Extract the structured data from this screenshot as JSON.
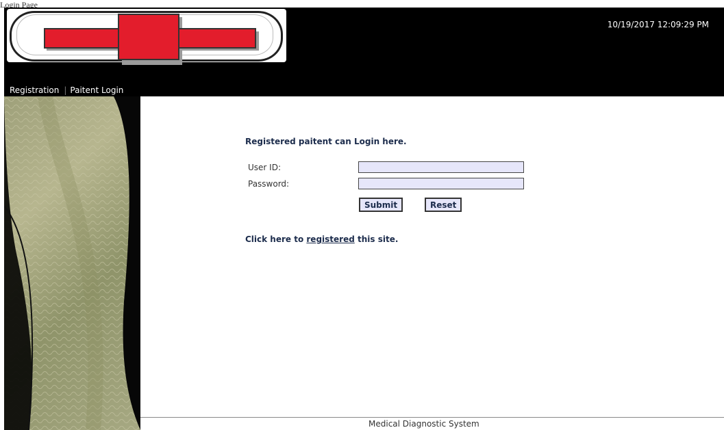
{
  "page": {
    "label": "Login Page"
  },
  "header": {
    "datetime": "10/19/2017 12:09:29 PM"
  },
  "nav": {
    "items": [
      {
        "label": "Registration"
      },
      {
        "label": "Paitent Login"
      }
    ]
  },
  "login": {
    "title": "Registered paitent can Login here.",
    "user_id_label": "User ID:",
    "user_id_value": "",
    "password_label": "Password:",
    "password_value": "",
    "submit_label": "Submit",
    "reset_label": "Reset"
  },
  "register_prompt": {
    "before": "Click here to ",
    "link": "registered",
    "after": " this site."
  },
  "footer": {
    "text": "Medical Diagnostic System"
  },
  "colors": {
    "header_bg": "#000000",
    "cross_red": "#e31d2c",
    "input_bg": "#e6e6fa",
    "title_text": "#1c2c4c"
  }
}
